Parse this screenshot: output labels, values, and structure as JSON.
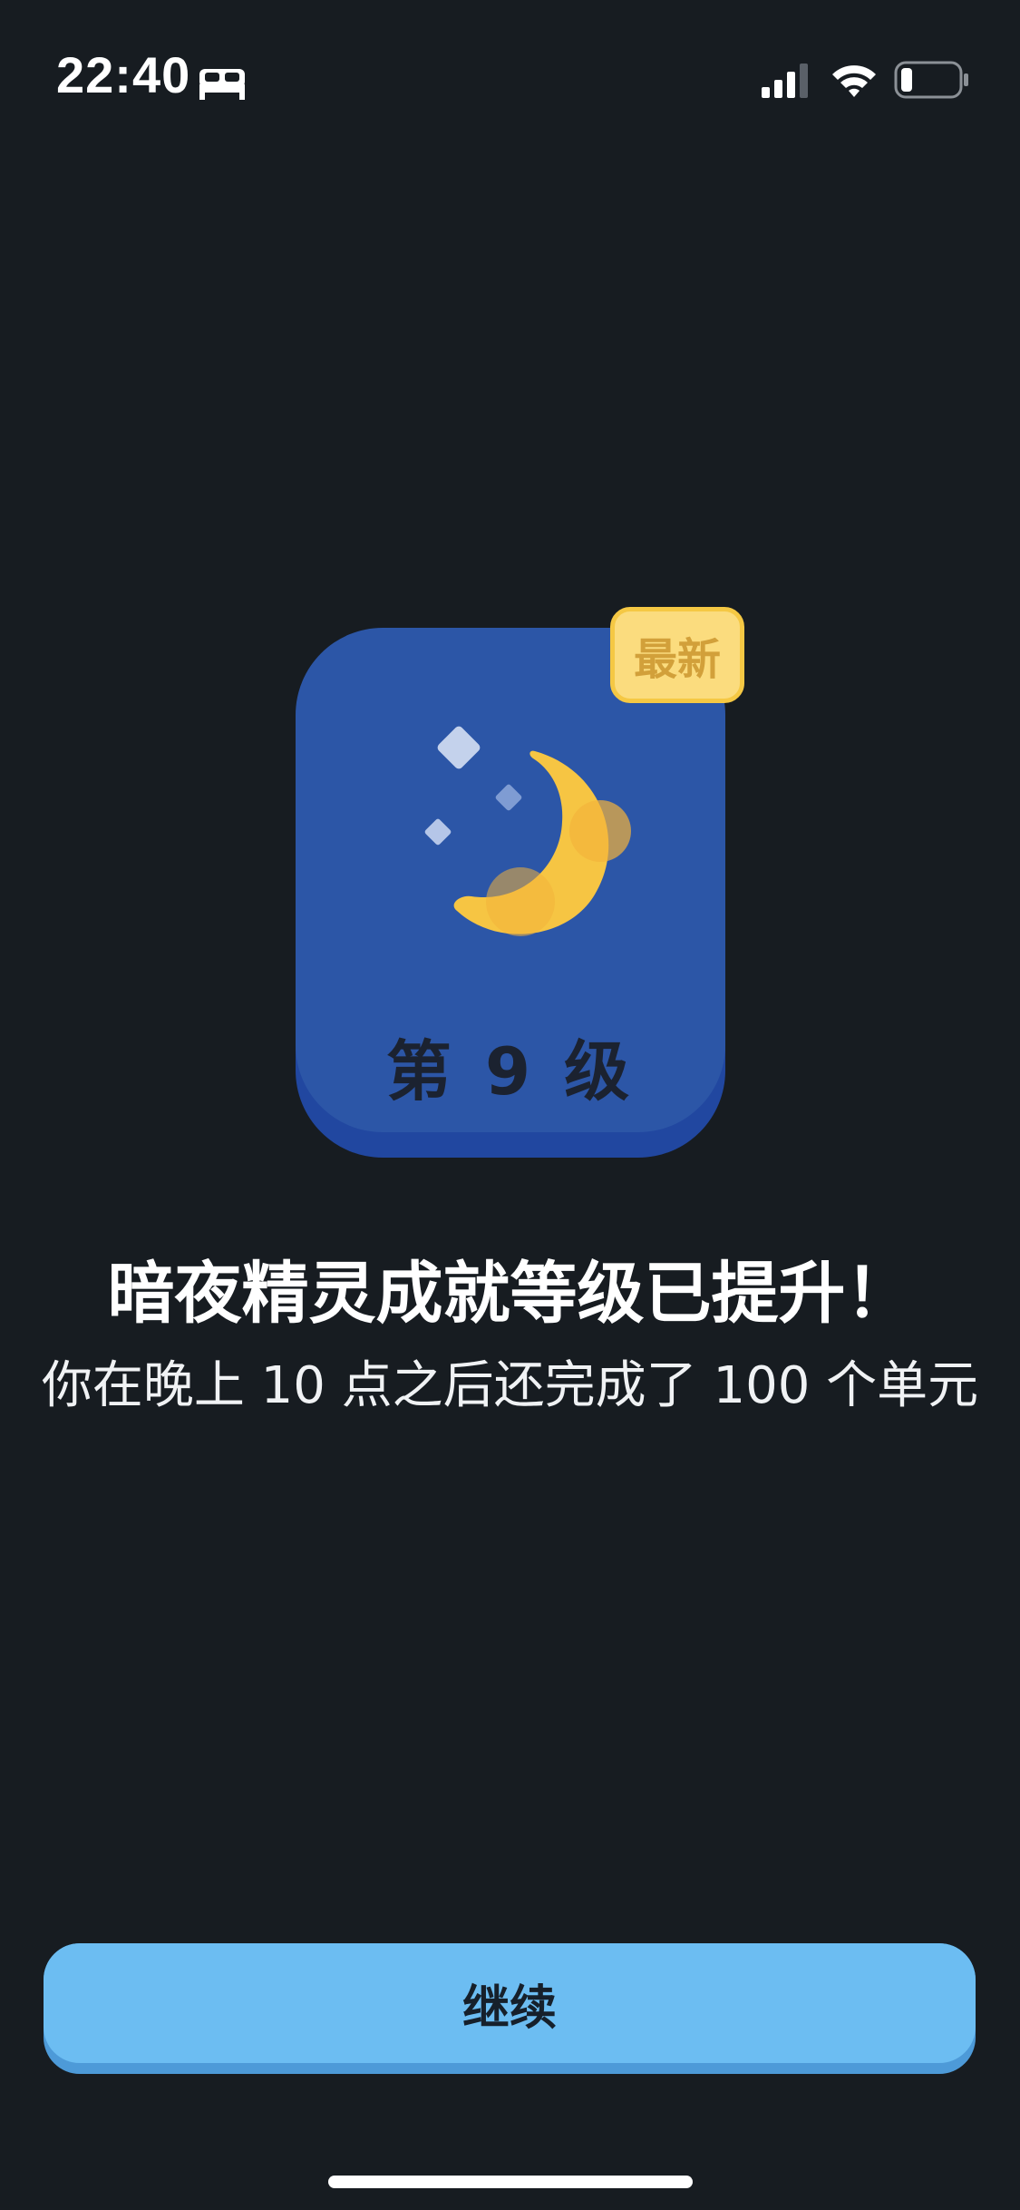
{
  "status_bar": {
    "time": "22:40",
    "icons": [
      "bed-icon",
      "signal-icon",
      "wifi-icon",
      "battery-icon"
    ]
  },
  "badge": {
    "level_label": "第 9 级",
    "new_tag": "最新",
    "icon": "moon-icon",
    "colors": {
      "card": "#2c56a7",
      "moon": "#f6c543",
      "tag_bg": "#fbdc7e",
      "tag_text": "#d2a03a"
    }
  },
  "message": {
    "title": "暗夜精灵成就等级已提升！",
    "subtitle": "你在晚上 10 点之后还完成了 100 个单元"
  },
  "actions": {
    "continue_label": "继续",
    "button_color": "#6cbdf2"
  }
}
